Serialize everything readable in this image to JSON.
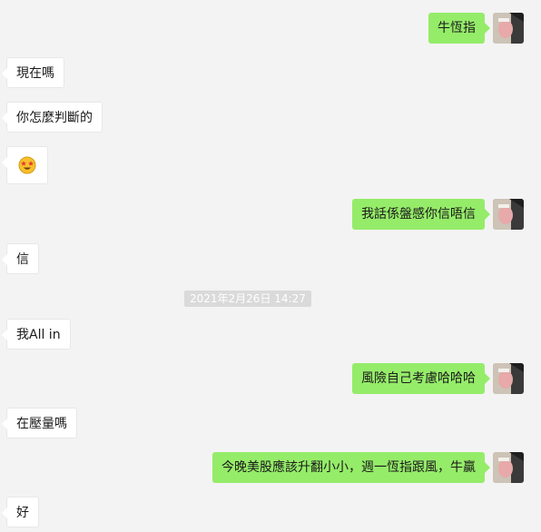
{
  "messages": [
    {
      "side": "out",
      "text": "牛恆指"
    },
    {
      "side": "in",
      "text": "現在嗎"
    },
    {
      "side": "in",
      "text": "你怎麼判斷的"
    },
    {
      "side": "in",
      "emoji": "star-struck-emoji"
    },
    {
      "side": "out",
      "text": "我話係盤感你信唔信"
    },
    {
      "side": "in",
      "text": "信"
    },
    {
      "side": "in",
      "text": "我All in"
    },
    {
      "side": "out",
      "text": "風險自己考慮哈哈哈"
    },
    {
      "side": "in",
      "text": "在壓量嗎"
    },
    {
      "side": "out",
      "text": "今晚美股應該升翻小小，週一恆指跟風，牛贏"
    },
    {
      "side": "in",
      "text": "好"
    }
  ],
  "timestamp": "2021年2月26日 14:27",
  "colors": {
    "background": "#f3f3f3",
    "outgoing_bubble": "#95ec69",
    "incoming_bubble": "#ffffff",
    "timestamp_bg": "#dadada"
  }
}
